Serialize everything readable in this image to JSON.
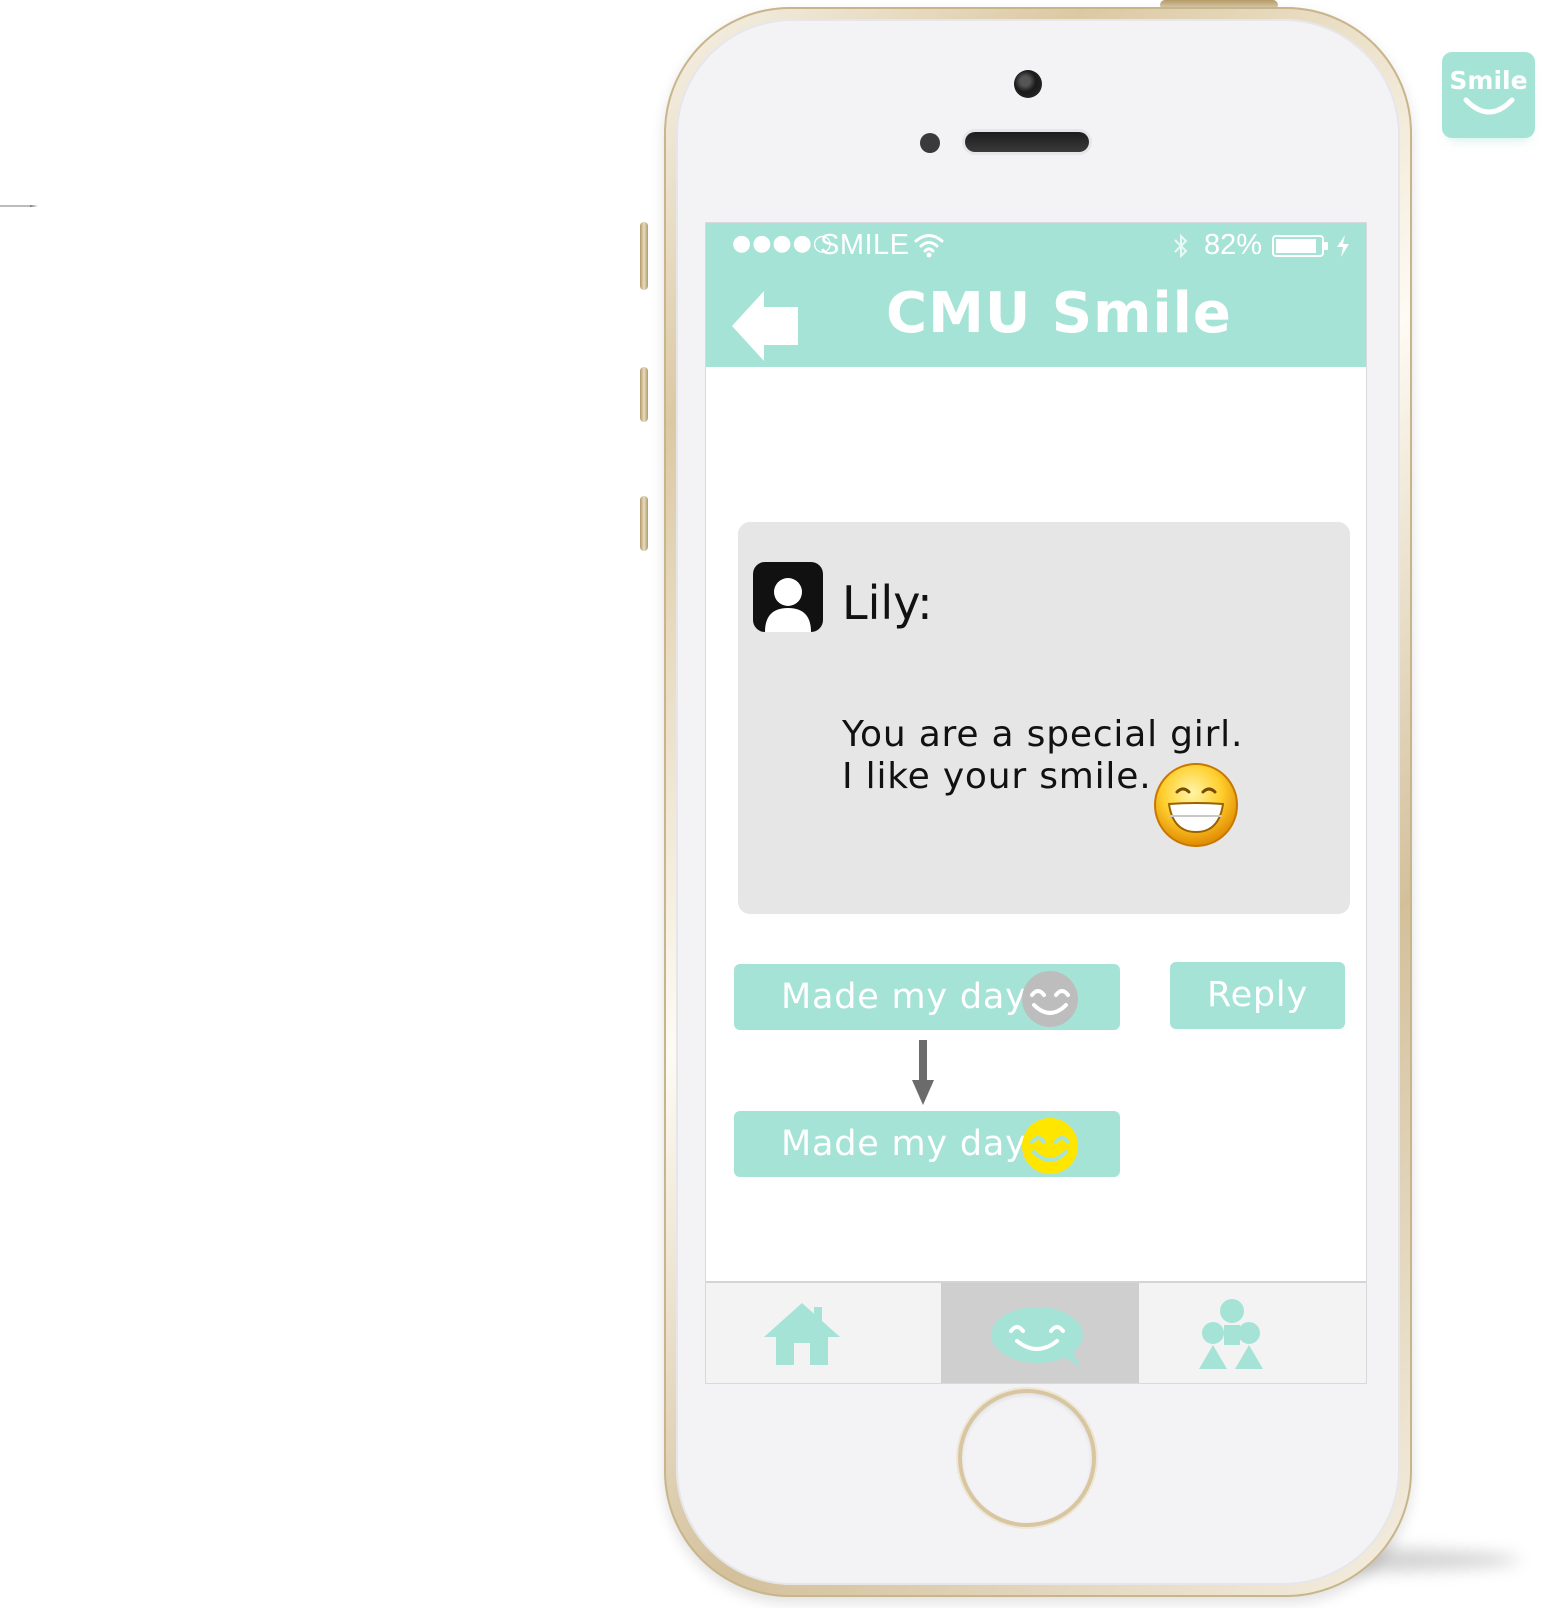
{
  "status_bar": {
    "signal": "●●●●○",
    "carrier": "SMILE",
    "battery_percent": "82%"
  },
  "nav": {
    "title": "CMU Smile"
  },
  "message": {
    "sender": "Lily:",
    "line1": "You are a special girl.",
    "line2": "I like your smile."
  },
  "actions": {
    "made_my_day_label": "Made my day!",
    "made_my_day_active_label": "Made my day!",
    "reply_label": "Reply"
  },
  "tabs": [
    {
      "icon": "home-icon",
      "selected": false
    },
    {
      "icon": "smile-chat-icon",
      "selected": true
    },
    {
      "icon": "people-icon",
      "selected": false
    }
  ],
  "app_logo": {
    "text": "Smile"
  },
  "colors": {
    "accent": "#a6e3d7",
    "card": "#e6e6e6",
    "tab_selected": "#cfcfcf",
    "smile_active": "#ffe600",
    "smile_inactive": "#bfbfbf"
  }
}
